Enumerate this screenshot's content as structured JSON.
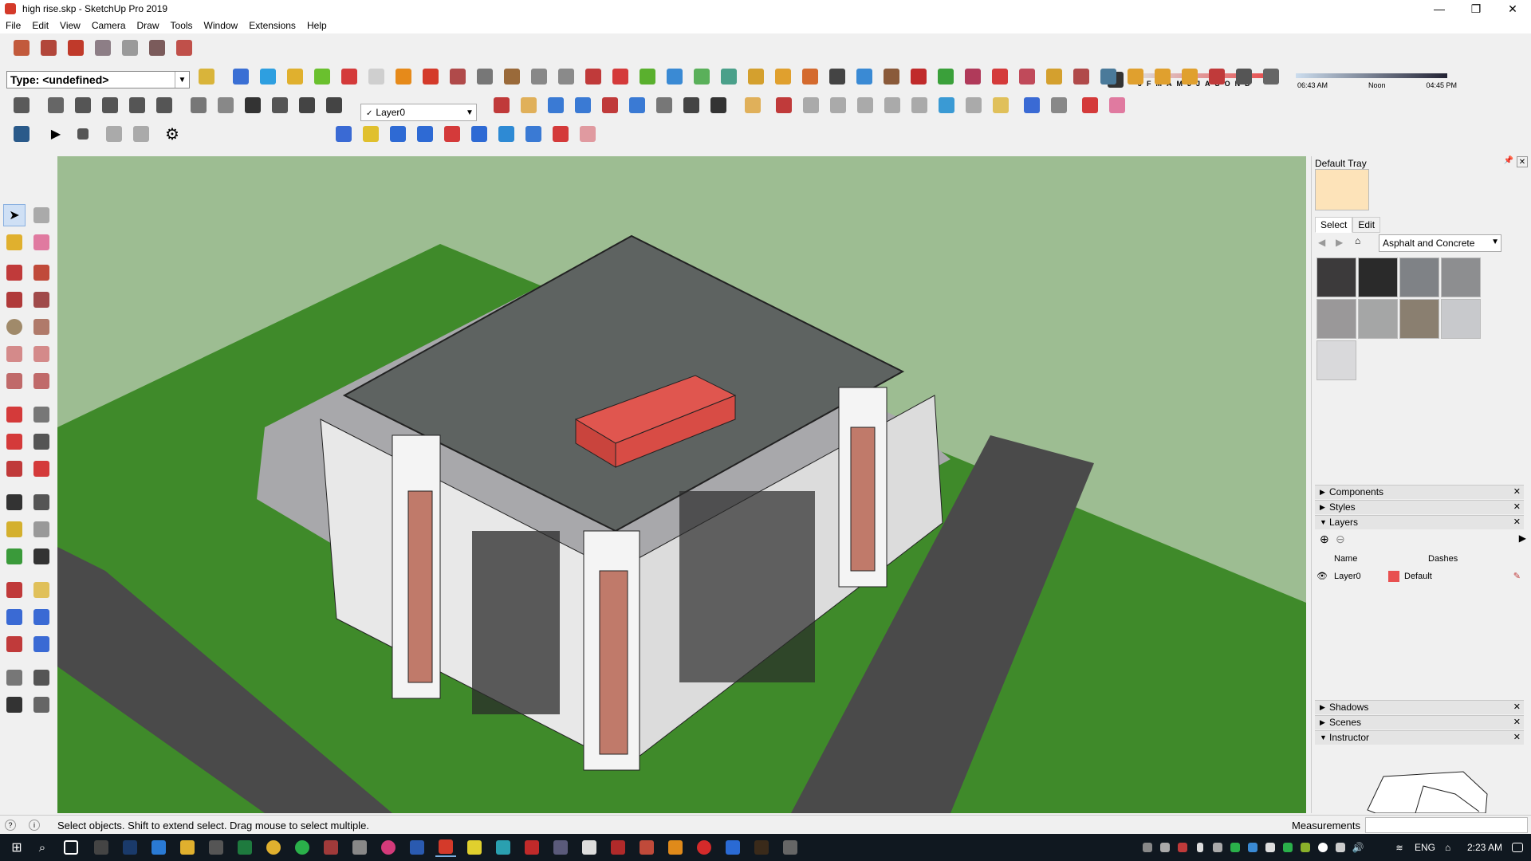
{
  "window": {
    "title": "high rise.skp - SketchUp Pro 2019",
    "controls": [
      "—",
      "❐",
      "✕"
    ]
  },
  "menu": [
    "File",
    "Edit",
    "View",
    "Camera",
    "Draw",
    "Tools",
    "Window",
    "Extensions",
    "Help"
  ],
  "entity_info": {
    "type_label": "Type: <undefined>"
  },
  "layer_toolbar": {
    "current_layer": "Layer0"
  },
  "shadows": {
    "months": [
      "J",
      "F",
      "M",
      "A",
      "M",
      "J",
      "J",
      "A",
      "S",
      "O",
      "N",
      "D"
    ],
    "time_start": "06:43 AM",
    "time_mid": "Noon",
    "time_end": "04:45 PM"
  },
  "tray": {
    "title": "Default Tray",
    "materials": {
      "tabs": [
        "Select",
        "Edit"
      ],
      "active_tab": "Select",
      "collection": "Asphalt and Concrete",
      "swatch_colors": [
        "#3c3a3b",
        "#2a2a2a",
        "#7f8286",
        "#8d8e90",
        "#9a9899",
        "#a5a6a6",
        "#8a7f70",
        "#c8c9cc",
        "#d9d9db"
      ],
      "selected_color": "#fde3b9"
    },
    "panels_top": [
      {
        "name": "Components",
        "expanded": false
      },
      {
        "name": "Styles",
        "expanded": false
      },
      {
        "name": "Layers",
        "expanded": true
      }
    ],
    "layers": {
      "columns": [
        "Name",
        "Dashes"
      ],
      "rows": [
        {
          "name": "Layer0",
          "color": "#e85050",
          "dashes": "Default"
        }
      ]
    },
    "panels_bottom": [
      {
        "name": "Shadows",
        "expanded": false
      },
      {
        "name": "Scenes",
        "expanded": false
      },
      {
        "name": "Instructor",
        "expanded": true
      }
    ]
  },
  "status": {
    "hint": "Select objects. Shift to extend select. Drag mouse to select multiple.",
    "measurements_label": "Measurements"
  },
  "taskbar": {
    "language": "ENG",
    "clock": "2:23 AM"
  },
  "colors": {
    "viewport_ground": "#9dbd92",
    "grass": "#3f8a2a",
    "roof": "#5e6361",
    "roof_box": "#e0564f",
    "road": "#4a4a4a",
    "paving": "#a8a8ab"
  }
}
